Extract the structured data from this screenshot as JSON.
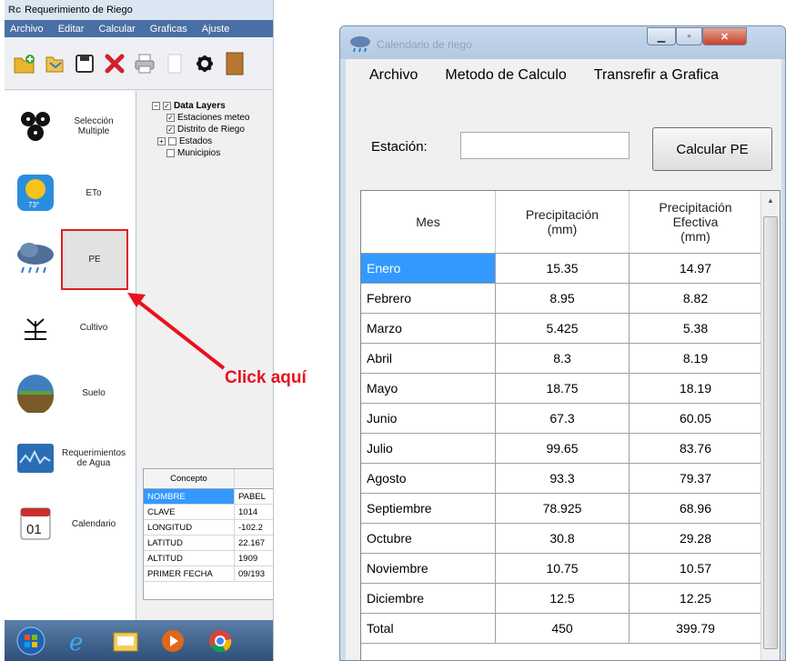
{
  "left_app": {
    "title": "Requerimiento de Riego",
    "menu": [
      "Archivo",
      "Editar",
      "Calcular",
      "Graficas",
      "Ajuste"
    ],
    "sidebar": [
      {
        "label": "Selección Multiple",
        "icon": "multi-selection-icon"
      },
      {
        "label": "ETo",
        "icon": "sun-icon"
      },
      {
        "label": "PE",
        "icon": "rain-cloud-icon"
      },
      {
        "label": "Cultivo",
        "icon": "crop-icon"
      },
      {
        "label": "Suelo",
        "icon": "soil-icon"
      },
      {
        "label": "Requerimientos de Agua",
        "icon": "water-chart-icon"
      },
      {
        "label": "Calendario",
        "icon": "calendar-icon"
      }
    ],
    "calendar_day": "01",
    "layers": {
      "root": "Data Layers",
      "items": [
        "Estaciones meteo",
        "Distrito de Riego",
        "Estados",
        "Municipios"
      ]
    },
    "concept": {
      "header": "Concepto",
      "rows": [
        {
          "key": "NOMBRE",
          "value": "PABEL"
        },
        {
          "key": "CLAVE",
          "value": "1014"
        },
        {
          "key": "LONGITUD",
          "value": "-102.2"
        },
        {
          "key": "LATITUD",
          "value": "22.167"
        },
        {
          "key": "ALTITUD",
          "value": "1909"
        },
        {
          "key": "PRIMER FECHA",
          "value": "09/193"
        }
      ]
    }
  },
  "annotation": {
    "text": "Click aquí",
    "color": "#e8121e"
  },
  "dialog": {
    "title": "Calendario de riego",
    "menu": [
      "Archivo",
      "Metodo de Calculo",
      "Transrefir a Grafica"
    ],
    "station_label": "Estación:",
    "station_value": "",
    "calc_button": "Calcular PE",
    "columns": [
      "Mes",
      "Precipitación (mm)",
      "Precipitación Efectiva (mm)"
    ],
    "rows": [
      {
        "mes": "Enero",
        "p": "15.35",
        "pe": "14.97"
      },
      {
        "mes": "Febrero",
        "p": "8.95",
        "pe": "8.82"
      },
      {
        "mes": "Marzo",
        "p": "5.425",
        "pe": "5.38"
      },
      {
        "mes": "Abril",
        "p": "8.3",
        "pe": "8.19"
      },
      {
        "mes": "Mayo",
        "p": "18.75",
        "pe": "18.19"
      },
      {
        "mes": "Junio",
        "p": "67.3",
        "pe": "60.05"
      },
      {
        "mes": "Julio",
        "p": "99.65",
        "pe": "83.76"
      },
      {
        "mes": "Agosto",
        "p": "93.3",
        "pe": "79.37"
      },
      {
        "mes": "Septiembre",
        "p": "78.925",
        "pe": "68.96"
      },
      {
        "mes": "Octubre",
        "p": "30.8",
        "pe": "29.28"
      },
      {
        "mes": "Noviembre",
        "p": "10.75",
        "pe": "10.57"
      },
      {
        "mes": "Diciembre",
        "p": "12.5",
        "pe": "12.25"
      },
      {
        "mes": "Total",
        "p": "450",
        "pe": "399.79"
      }
    ]
  },
  "colors": {
    "selection": "#3399ff",
    "highlight_box": "#e02020",
    "annotation": "#e8121e"
  }
}
